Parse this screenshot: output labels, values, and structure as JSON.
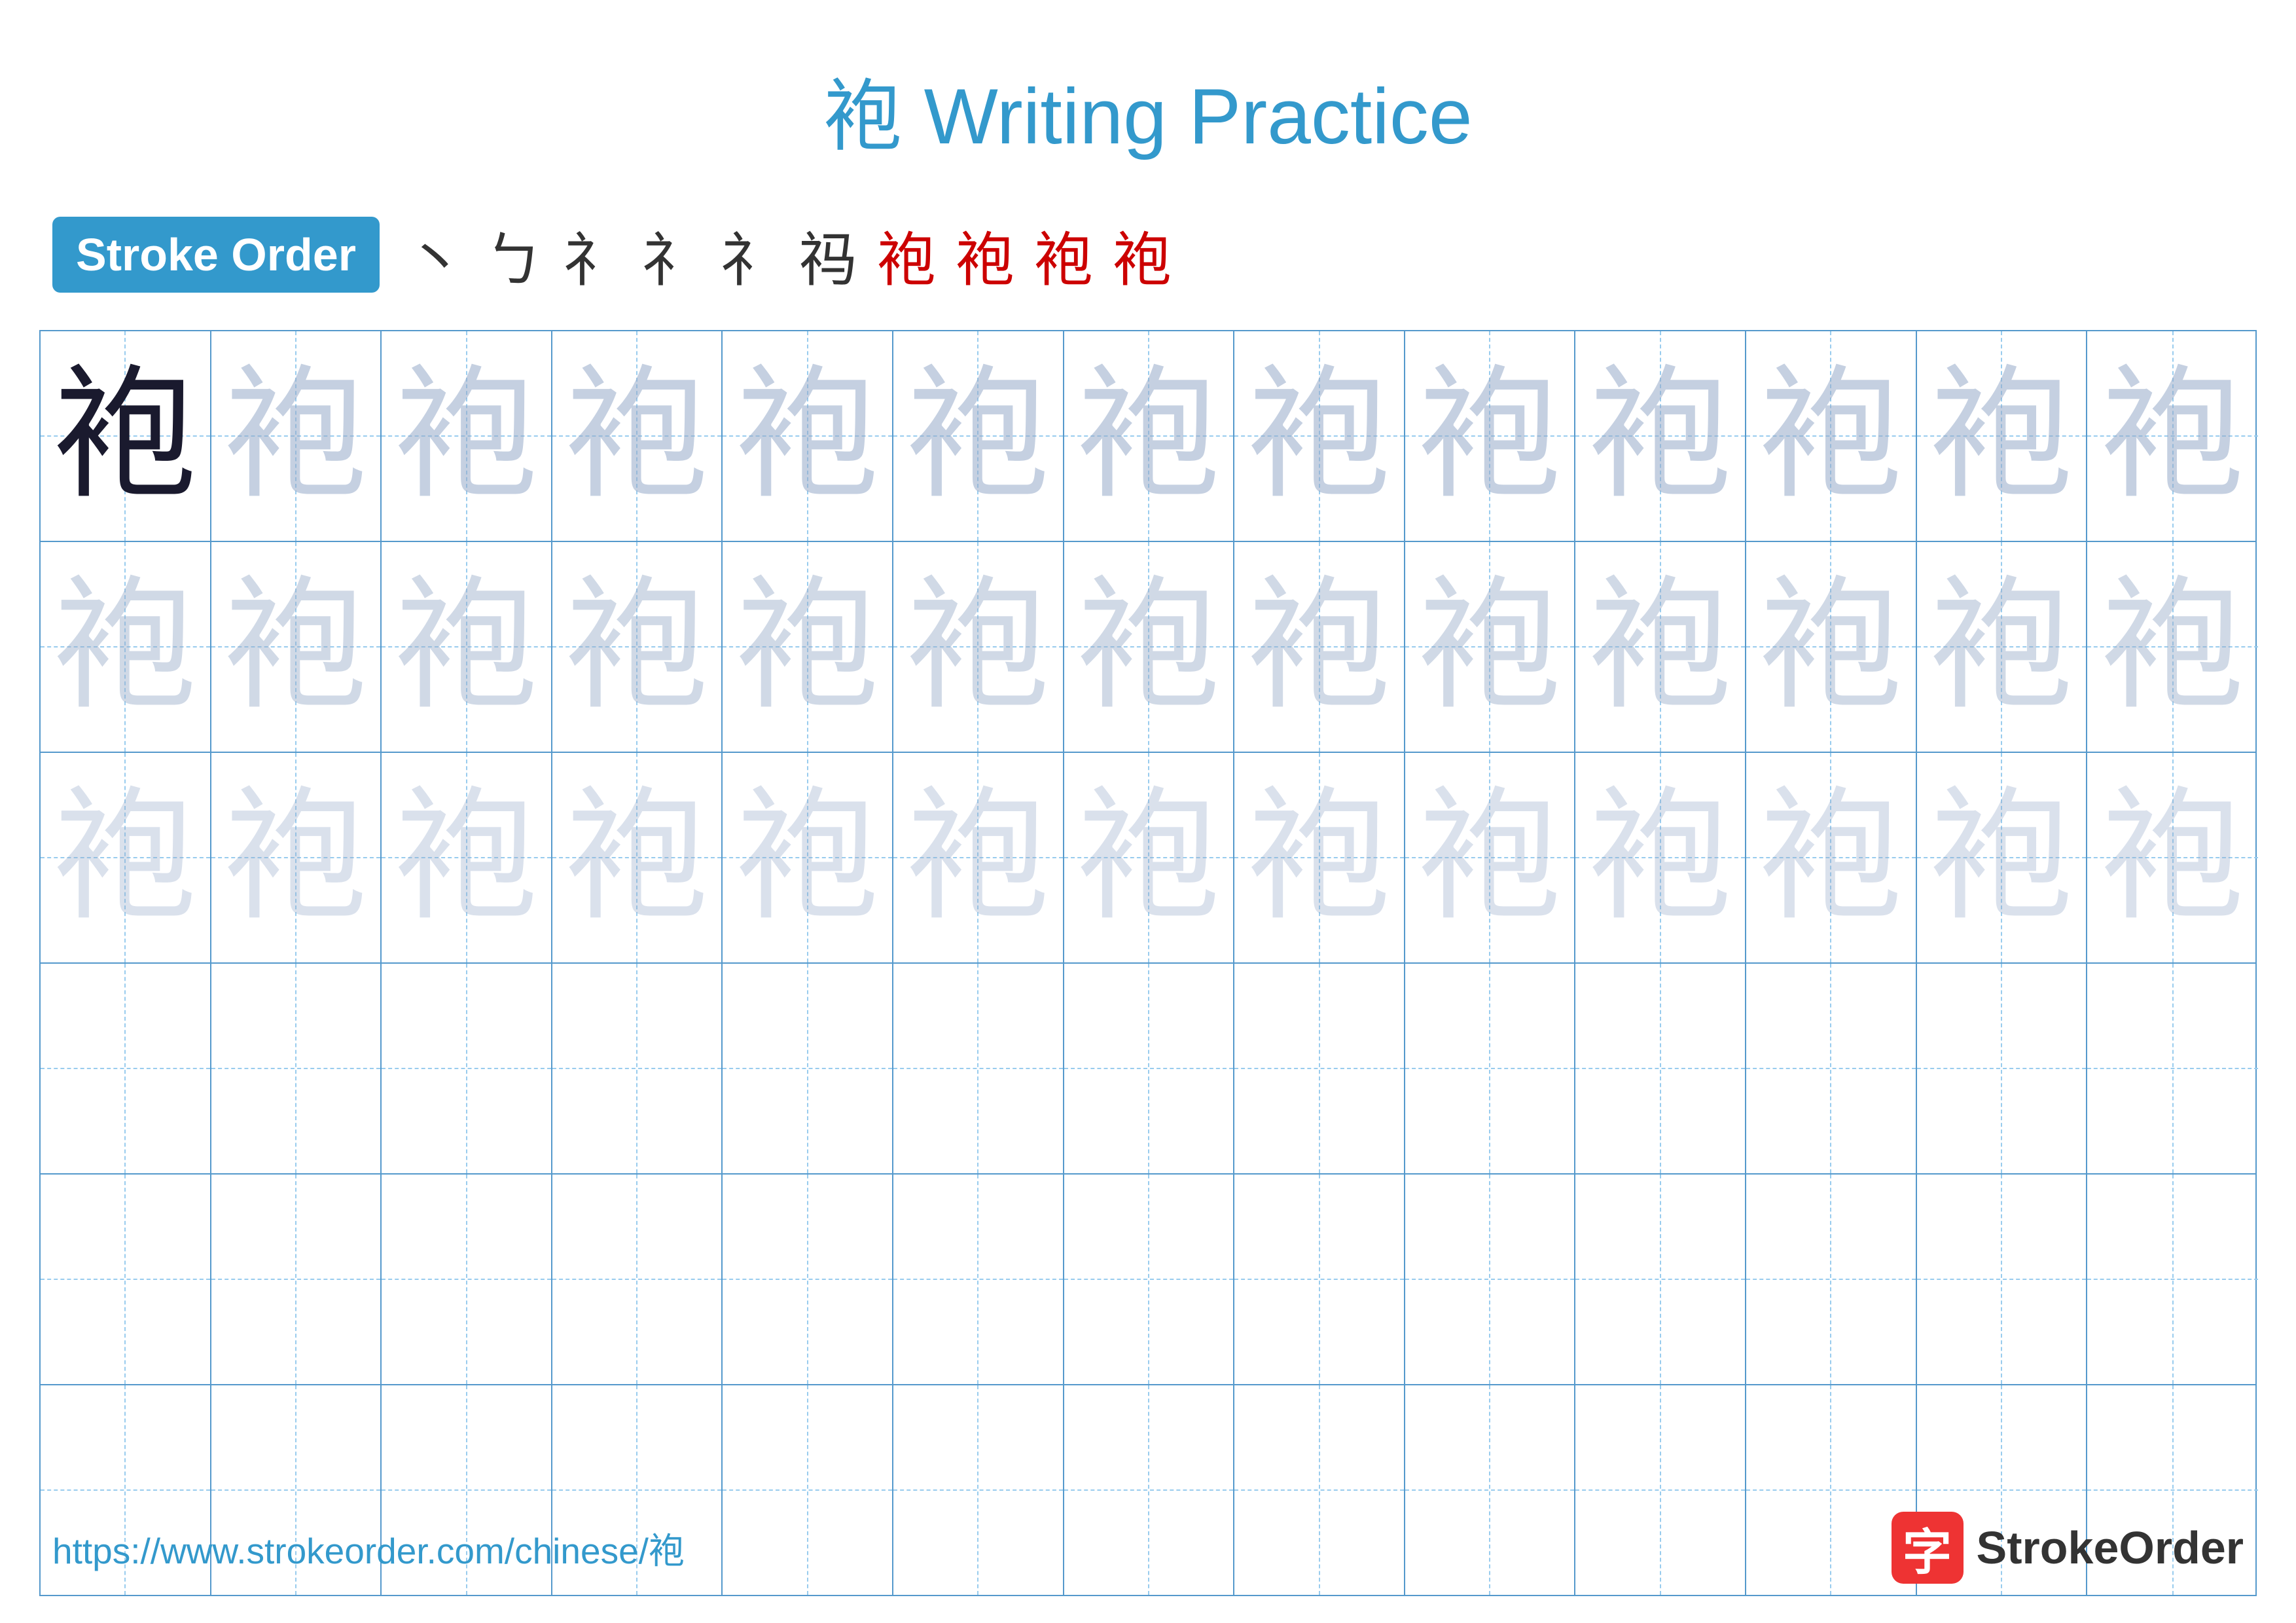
{
  "page": {
    "title": "袍 Writing Practice",
    "title_char": "袍",
    "title_text": " Writing Practice"
  },
  "stroke_order": {
    "badge_label": "Stroke Order",
    "strokes": [
      "丶",
      "ㄅ",
      "礻",
      "礻",
      "礻",
      "袄",
      "袍",
      "袍",
      "袍",
      "袍"
    ]
  },
  "character": "袍",
  "grid": {
    "rows": 6,
    "cols": 13
  },
  "footer": {
    "url": "https://www.strokeorder.com/chinese/袍",
    "brand_name": "StrokeOrder",
    "brand_char": "字"
  }
}
